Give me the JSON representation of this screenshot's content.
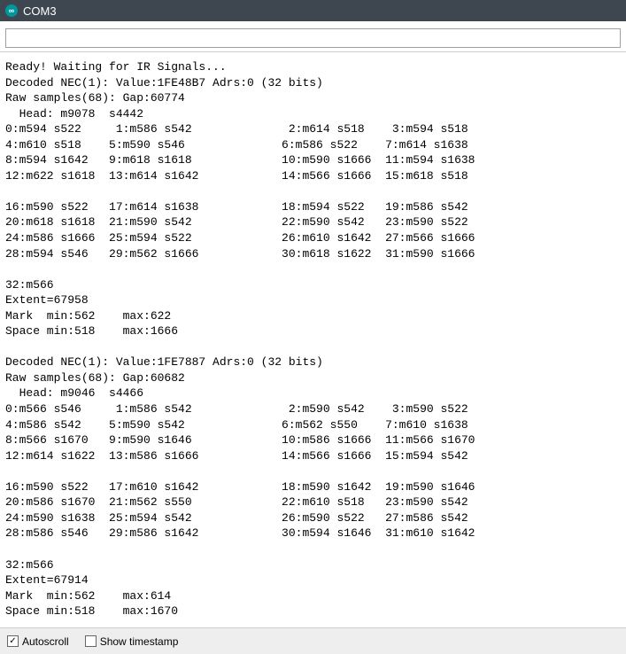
{
  "titlebar": {
    "title": "COM3"
  },
  "input": {
    "value": ""
  },
  "footer": {
    "autoscroll_label": "Autoscroll",
    "autoscroll_checked": true,
    "showtimestamp_label": "Show timestamp",
    "showtimestamp_checked": false
  },
  "lines": [
    "Ready! Waiting for IR Signals...",
    "Decoded NEC(1): Value:1FE48B7 Adrs:0 (32 bits)",
    "Raw samples(68): Gap:60774",
    "  Head: m9078  s4442",
    "0:m594 s522     1:m586 s542              2:m614 s518    3:m594 s518",
    "4:m610 s518    5:m590 s546              6:m586 s522    7:m614 s1638",
    "8:m594 s1642   9:m618 s1618             10:m590 s1666  11:m594 s1638",
    "12:m622 s1618  13:m614 s1642            14:m566 s1666  15:m618 s518",
    "",
    "16:m590 s522   17:m614 s1638            18:m594 s522   19:m586 s542",
    "20:m618 s1618  21:m590 s542             22:m590 s542   23:m590 s522",
    "24:m586 s1666  25:m594 s522             26:m610 s1642  27:m566 s1666",
    "28:m594 s546   29:m562 s1666            30:m618 s1622  31:m590 s1666",
    "",
    "32:m566",
    "Extent=67958",
    "Mark  min:562    max:622",
    "Space min:518    max:1666",
    "",
    "Decoded NEC(1): Value:1FE7887 Adrs:0 (32 bits)",
    "Raw samples(68): Gap:60682",
    "  Head: m9046  s4466",
    "0:m566 s546     1:m586 s542              2:m590 s542    3:m590 s522",
    "4:m586 s542    5:m590 s542              6:m562 s550    7:m610 s1638",
    "8:m566 s1670   9:m590 s1646             10:m586 s1666  11:m566 s1670",
    "12:m614 s1622  13:m586 s1666            14:m566 s1666  15:m594 s542",
    "",
    "16:m590 s522   17:m610 s1642            18:m590 s1642  19:m590 s1646",
    "20:m586 s1670  21:m562 s550             22:m610 s518   23:m590 s542",
    "24:m590 s1638  25:m594 s542             26:m590 s522   27:m586 s542",
    "28:m586 s546   29:m586 s1642            30:m594 s1646  31:m610 s1642",
    "",
    "32:m566",
    "Extent=67914",
    "Mark  min:562    max:614",
    "Space min:518    max:1670",
    ""
  ]
}
